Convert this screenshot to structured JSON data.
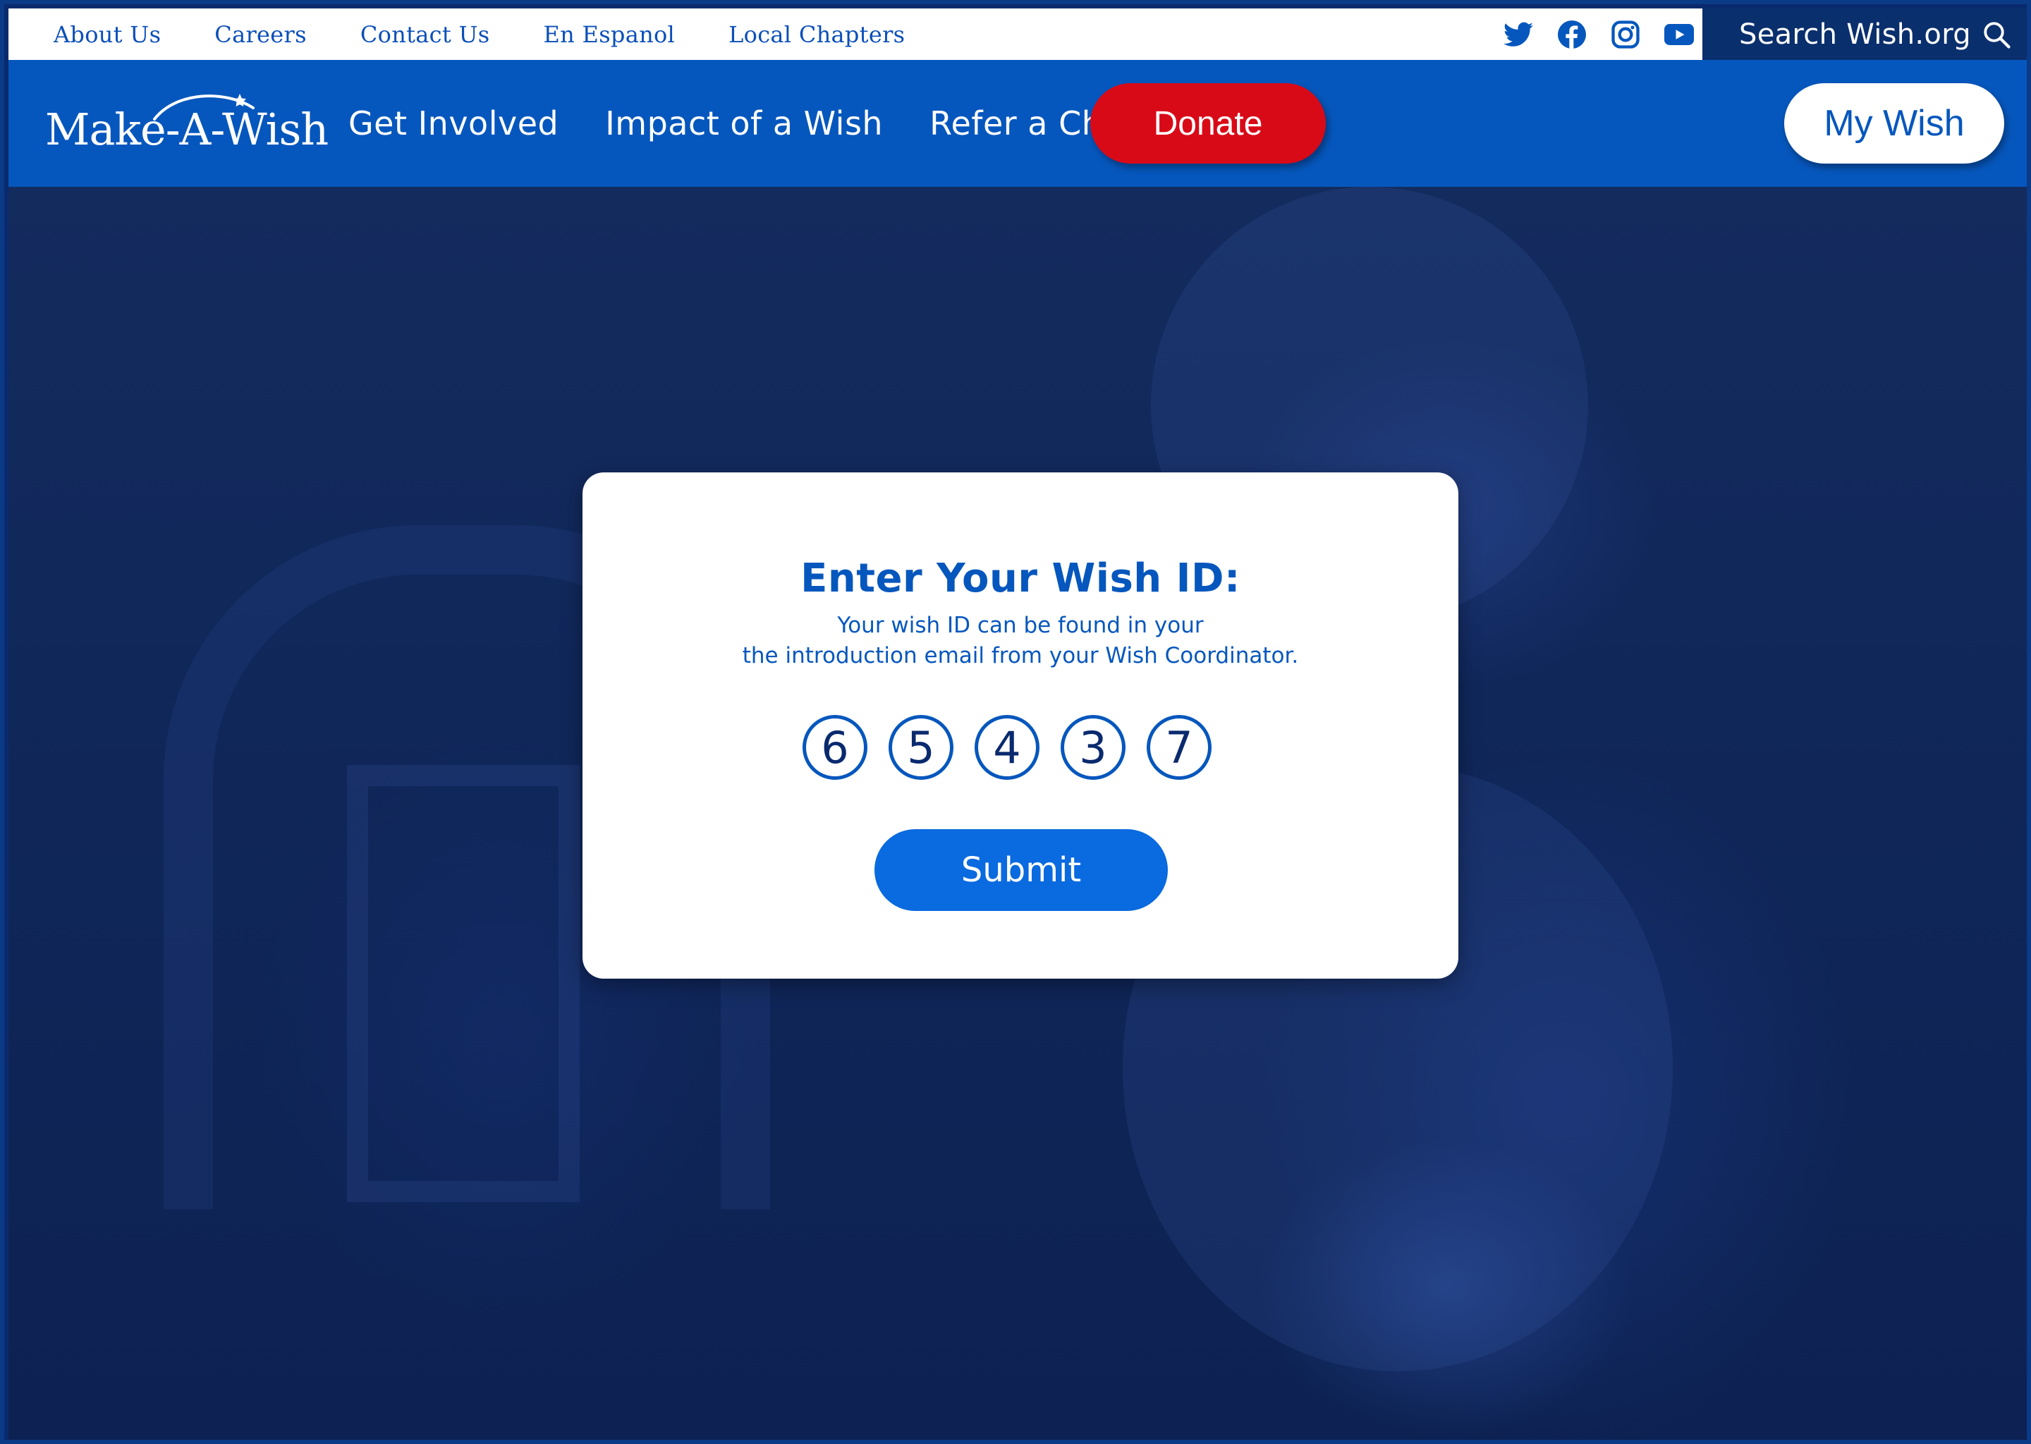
{
  "utility_nav": {
    "links": [
      "About Us",
      "Careers",
      "Contact Us",
      "En Espanol",
      "Local Chapters"
    ],
    "social": [
      "twitter-icon",
      "facebook-icon",
      "instagram-icon",
      "youtube-icon"
    ],
    "search_label": "Search Wish.org"
  },
  "main_nav": {
    "logo_text": "Make-A-Wish",
    "links": [
      "Get Involved",
      "Impact of a Wish",
      "Refer a Child"
    ],
    "donate_label": "Donate",
    "my_wish_label": "My Wish"
  },
  "card": {
    "title": "Enter Your Wish ID:",
    "subtitle_line1": "Your wish ID can be found in your",
    "subtitle_line2": "the introduction email from your Wish Coordinator.",
    "digits": [
      "6",
      "5",
      "4",
      "3",
      "7"
    ],
    "submit_label": "Submit"
  },
  "colors": {
    "brand_blue": "#0657bd",
    "dark_blue": "#0a2f6d",
    "donate_red": "#d90a18",
    "submit_blue": "#0a6adf"
  }
}
